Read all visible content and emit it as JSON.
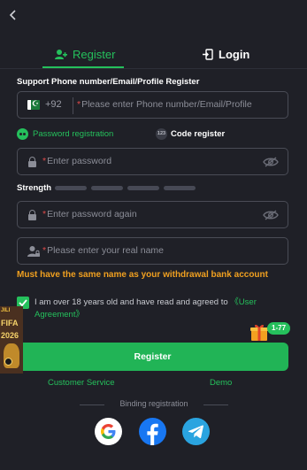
{
  "nav": {
    "back_icon": "chevron-left-icon"
  },
  "tabs": [
    {
      "label": "Register",
      "icon": "user-plus-icon",
      "active": true
    },
    {
      "label": "Login",
      "icon": "login-door-icon",
      "active": false
    }
  ],
  "support_text": "Support Phone number/Email/Profile Register",
  "phone": {
    "country_code": "+92",
    "flag": "pakistan-flag-icon",
    "required_mark": "*",
    "placeholder": "Please enter Phone number/Email/Profile"
  },
  "registration_methods": {
    "password": "Password registration",
    "code": "Code register",
    "code_icon_text": "123"
  },
  "password": {
    "required_mark": "*",
    "placeholder": "Enter password"
  },
  "strength": {
    "label": "Strength",
    "level": 0,
    "segments": 4
  },
  "password_again": {
    "required_mark": "*",
    "placeholder": "Enter password again"
  },
  "real_name": {
    "required_mark": "*",
    "placeholder": "Please enter your real name"
  },
  "warning": "Must have the same name as your withdrawal bank account",
  "agreement": {
    "checked": true,
    "text": "I am over 18 years old and have read and agreed to",
    "link": "《User Agreement》"
  },
  "register_button": "Register",
  "footer": {
    "customer_service": "Customer Service",
    "demo": "Demo"
  },
  "binding": {
    "label": "Binding registration"
  },
  "social": [
    "google-icon",
    "facebook-icon",
    "telegram-icon"
  ],
  "promo": {
    "fifa_line1": "JILI",
    "fifa_line2": "FIFA",
    "fifa_line3": "2026",
    "gift_badge": "1-77"
  },
  "colors": {
    "background": "#1f2027",
    "accent": "#25c05c",
    "warning": "#f0a020",
    "input_border": "#4a4c56"
  }
}
